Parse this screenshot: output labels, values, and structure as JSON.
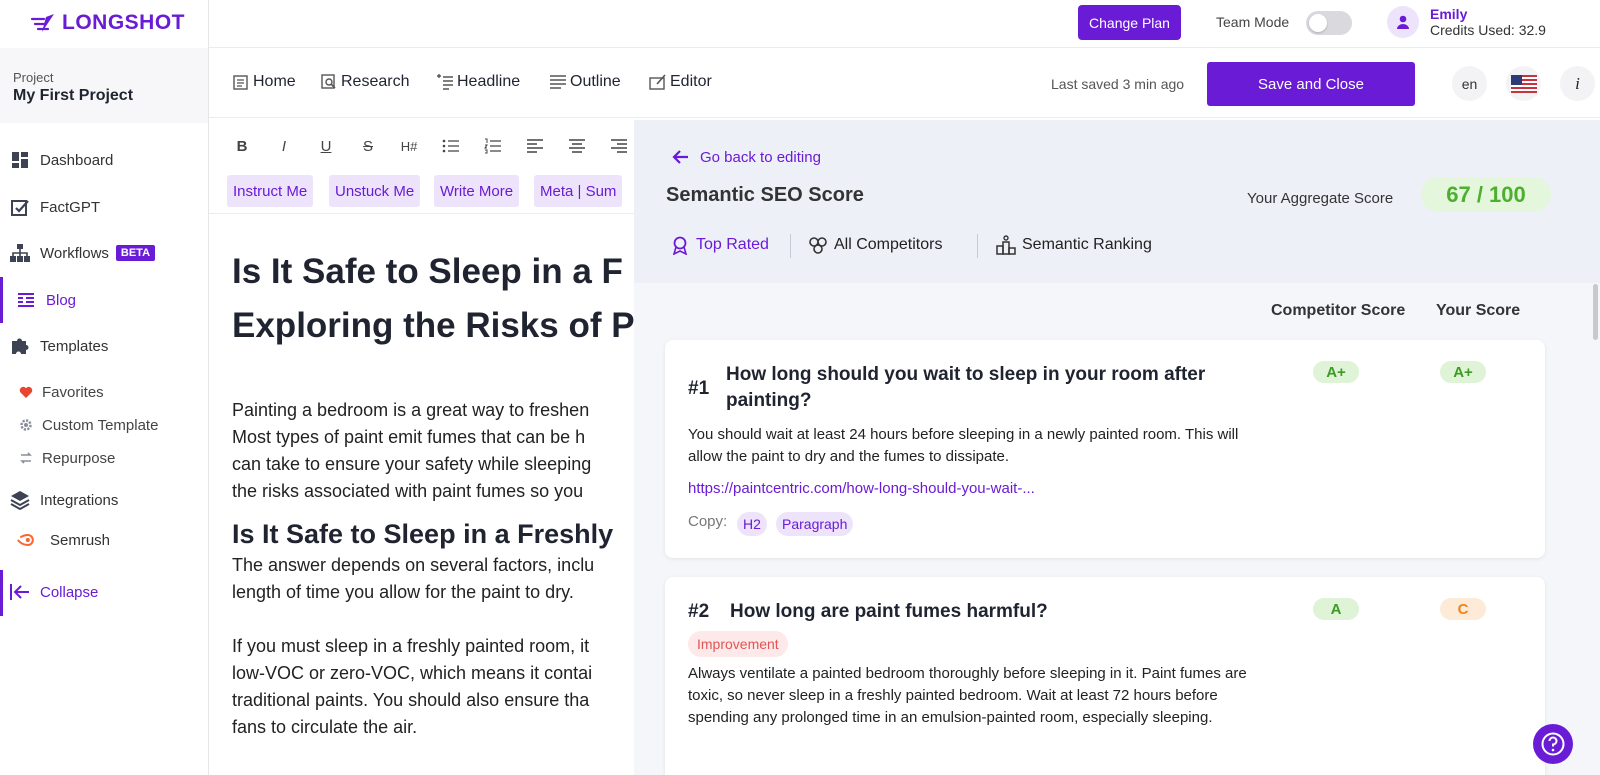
{
  "brand": {
    "logo_text": "LONGSHOT",
    "accent_color": "#6a1bd6"
  },
  "project": {
    "label": "Project",
    "name": "My First Project"
  },
  "sidebar": {
    "items": [
      {
        "label": "Dashboard",
        "icon": "dashboard-icon"
      },
      {
        "label": "FactGPT",
        "icon": "check-square-icon"
      },
      {
        "label": "Workflows",
        "icon": "workflow-icon",
        "badge": "BETA"
      },
      {
        "label": "Blog",
        "icon": "blog-icon",
        "active": true
      },
      {
        "label": "Templates",
        "icon": "puzzle-icon"
      },
      {
        "label": "Favorites",
        "icon": "heart-icon"
      },
      {
        "label": "Custom Template",
        "icon": "gear-icon"
      },
      {
        "label": "Repurpose",
        "icon": "repurpose-icon"
      },
      {
        "label": "Integrations",
        "icon": "layers-icon"
      },
      {
        "label": "Semrush",
        "icon": "semrush-icon"
      },
      {
        "label": "Collapse",
        "icon": "collapse-icon"
      }
    ]
  },
  "header": {
    "change_plan": "Change Plan",
    "team_mode": "Team Mode",
    "user_name": "Emily",
    "credits": "Credits Used: 32.9"
  },
  "tabs": [
    {
      "label": "Home",
      "icon": "home-icon"
    },
    {
      "label": "Research",
      "icon": "research-icon"
    },
    {
      "label": "Headline",
      "icon": "headline-icon"
    },
    {
      "label": "Outline",
      "icon": "outline-icon"
    },
    {
      "label": "Editor",
      "icon": "editor-icon"
    }
  ],
  "toolbar": {
    "last_saved": "Last saved 3 min ago",
    "save_close": "Save and Close",
    "language": "en"
  },
  "editor": {
    "format_buttons": [
      "B",
      "I",
      "U",
      "S",
      "H#"
    ],
    "ai_buttons": [
      "Instruct Me",
      "Unstuck Me",
      "Write More",
      "Meta | Sum"
    ],
    "title_line1": "Is It Safe to Sleep in a F",
    "title_line2": "Exploring the Risks of P",
    "para1": [
      "Painting a bedroom is a great way to freshen",
      "Most types of paint emit fumes that can be h",
      "can take to ensure your safety while sleeping",
      "the risks associated with paint fumes so you"
    ],
    "h2": "Is It Safe to Sleep in a Freshly",
    "para2": [
      "The answer depends on several factors, inclu",
      "length of time you allow for the paint to dry."
    ],
    "para3": [
      "If you must sleep in a freshly painted room, it",
      "low-VOC or zero-VOC, which means it contai",
      "traditional paints. You should also ensure tha",
      "fans to circulate the air."
    ]
  },
  "seo": {
    "back_label": "Go back to editing",
    "title": "Semantic SEO Score",
    "aggregate_label": "Your Aggregate Score",
    "aggregate_score": "67 / 100",
    "tabs": [
      "Top Rated",
      "All Competitors",
      "Semantic Ranking"
    ],
    "col_competitor": "Competitor Score",
    "col_yours": "Your Score",
    "copy_label": "Copy:",
    "cards": [
      {
        "rank": "#1",
        "question": "How long should you wait to sleep in your room after painting?",
        "answer": "You should wait at least 24 hours before sleeping in a newly painted room. This will allow the paint to dry and the fumes to dissipate.",
        "link": "https://paintcentric.com/how-long-should-you-wait-...",
        "tags": [
          "H2",
          "Paragraph"
        ],
        "competitor_score": "A+",
        "your_score": "A+"
      },
      {
        "rank": "#2",
        "question": "How long are paint fumes harmful?",
        "badge": "Improvement",
        "answer": "Always ventilate a painted bedroom thoroughly before sleeping in it. Paint fumes are toxic, so never sleep in a freshly painted bedroom. Wait at least 72 hours before spending any prolonged time in an emulsion-painted room, especially sleeping.",
        "competitor_score": "A",
        "your_score": "C"
      }
    ]
  }
}
